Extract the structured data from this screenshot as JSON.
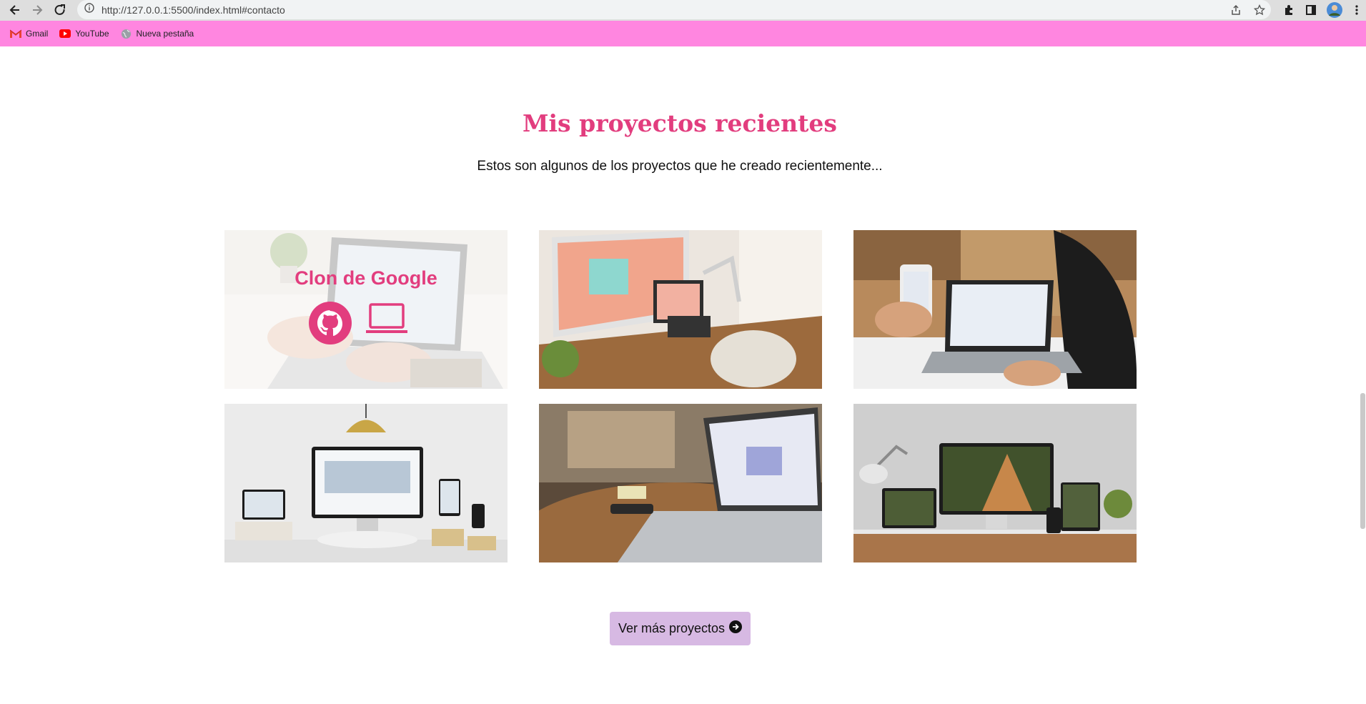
{
  "browser": {
    "url": "http://127.0.0.1:5500/index.html#contacto",
    "bookmarks": [
      {
        "label": "Gmail",
        "icon": "gmail-icon"
      },
      {
        "label": "YouTube",
        "icon": "youtube-icon"
      },
      {
        "label": "Nueva pestaña",
        "icon": "globe-icon"
      }
    ]
  },
  "section": {
    "title": "Mis proyectos recientes",
    "subtitle": "Estos son algunos de los proyectos que he creado recientemente..."
  },
  "projects": [
    {
      "title": "Clon de Google",
      "image": "laptop-typing-photo",
      "hover": true
    },
    {
      "image": "desktop-find-your-creativity-photo"
    },
    {
      "image": "phone-and-laptop-photo"
    },
    {
      "image": "responsive-web-design-photo"
    },
    {
      "image": "laptop-wooden-table-photo"
    },
    {
      "image": "architect-studio-devices-photo"
    }
  ],
  "cta": {
    "label": "Ver más proyectos"
  },
  "colors": {
    "accent": "#e23d7e",
    "bookmark_bar": "#ff86e0",
    "button_bg": "#d7b9e3"
  }
}
